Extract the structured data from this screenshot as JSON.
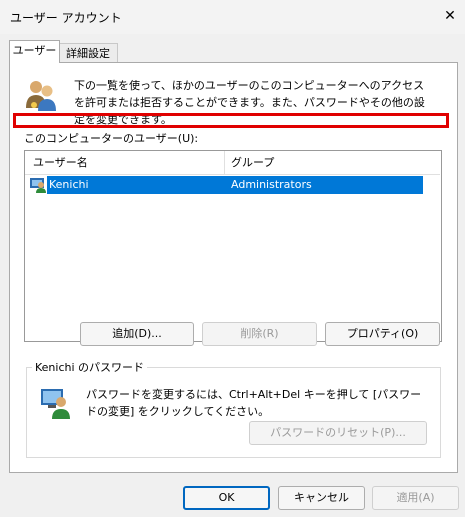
{
  "window": {
    "title": "ユーザー アカウント",
    "close_glyph": "✕"
  },
  "tabs": [
    {
      "label": "ユーザー"
    },
    {
      "label": "詳細設定"
    }
  ],
  "description": "下の一覧を使って、ほかのユーザーのこのコンピューターへのアクセスを許可または拒否することができます。また、パスワードやその他の設定を変更できます。",
  "users_list": {
    "label": "このコンピューターのユーザー(U):",
    "columns": [
      "ユーザー名",
      "グループ"
    ],
    "rows": [
      {
        "name": "Kenichi",
        "group": "Administrators",
        "selected": true
      }
    ]
  },
  "buttons": {
    "add": "追加(D)...",
    "remove": "削除(R)",
    "properties": "プロパティ(O)"
  },
  "password_group": {
    "title": "Kenichi のパスワード",
    "text": "パスワードを変更するには、Ctrl+Alt+Del キーを押して [パスワードの変更] をクリックしてください。",
    "reset_button": "パスワードのリセット(P)..."
  },
  "footer": {
    "ok": "OK",
    "cancel": "キャンセル",
    "apply": "適用(A)"
  },
  "colors": {
    "selection": "#0078d7",
    "highlight_box": "#e00000"
  }
}
